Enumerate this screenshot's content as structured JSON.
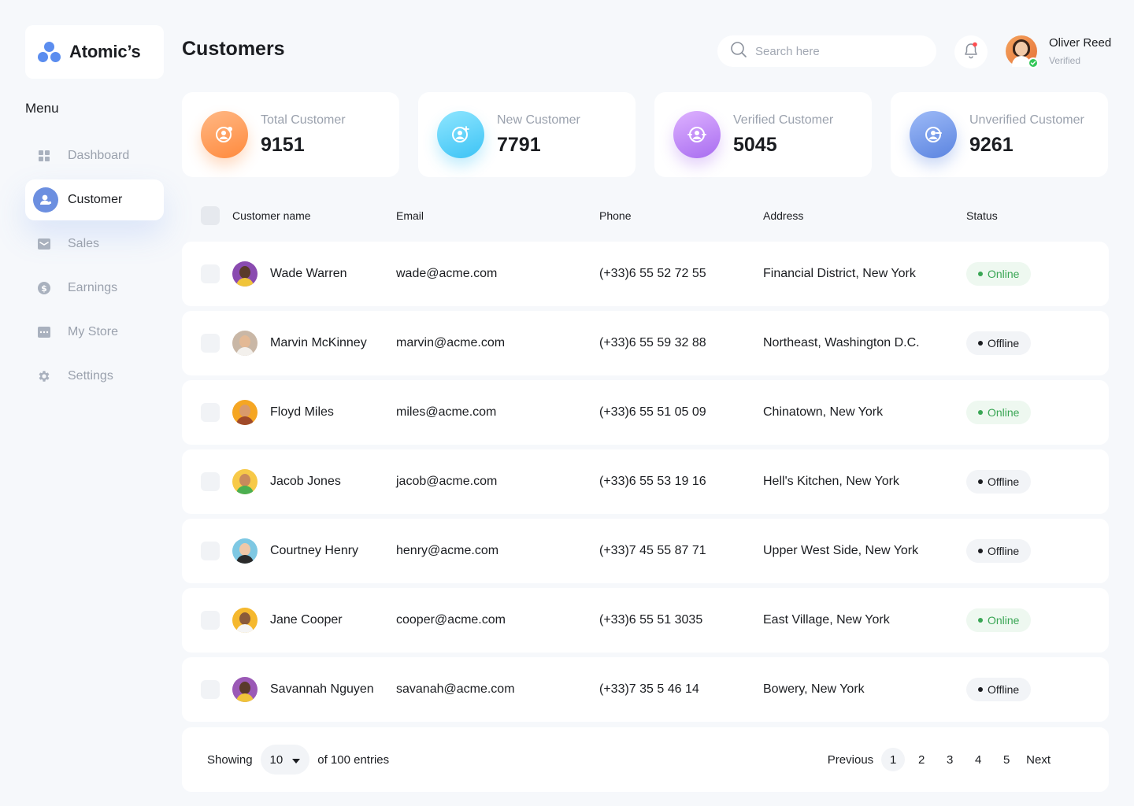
{
  "brand": {
    "name": "Atomic’s",
    "color": "#5b8def"
  },
  "sidebar": {
    "menu_title": "Menu",
    "items": [
      {
        "label": "Dashboard",
        "icon": "grid-icon",
        "active": false
      },
      {
        "label": "Customer",
        "icon": "user-icon",
        "active": true
      },
      {
        "label": "Sales",
        "icon": "inbox-icon",
        "active": false
      },
      {
        "label": "Earnings",
        "icon": "dollar-icon",
        "active": false
      },
      {
        "label": "My Store",
        "icon": "store-icon",
        "active": false
      },
      {
        "label": "Settings",
        "icon": "gear-icon",
        "active": false
      }
    ]
  },
  "header": {
    "title": "Customers",
    "search_placeholder": "Search here",
    "user": {
      "name": "Oliver Reed",
      "status": "Verified"
    }
  },
  "stats": [
    {
      "label": "Total Customer",
      "value": "9151",
      "color_from": "#ffb07a",
      "color_to": "#ff8a3d"
    },
    {
      "label": "New Customer",
      "value": "7791",
      "color_from": "#7fe0ff",
      "color_to": "#3cc3f5"
    },
    {
      "label": "Verified Customer",
      "value": "5045",
      "color_from": "#d6a6ff",
      "color_to": "#a86cf0"
    },
    {
      "label": "Unverified Customer",
      "value": "9261",
      "color_from": "#8fb0f5",
      "color_to": "#5b84e0"
    }
  ],
  "table": {
    "headers": {
      "name": "Customer name",
      "email": "Email",
      "phone": "Phone",
      "address": "Address",
      "status": "Status"
    },
    "rows": [
      {
        "name": "Wade Warren",
        "email": "wade@acme.com",
        "phone": "(+33)6 55 52 72 55",
        "address": "Financial District, New York",
        "status": "Online",
        "avatar_bg": "#8a4bb0",
        "skin": "#5a3a2a",
        "shirt": "#f0c43a"
      },
      {
        "name": "Marvin McKinney",
        "email": "marvin@acme.com",
        "phone": "(+33)6 55 59 32 88",
        "address": "Northeast, Washington D.C.",
        "status": "Offline",
        "avatar_bg": "#c9b7a6",
        "skin": "#e3b995",
        "shirt": "#f3f0ec"
      },
      {
        "name": "Floyd Miles",
        "email": "miles@acme.com",
        "phone": "(+33)6 55 51 05 09",
        "address": "Chinatown, New York",
        "status": "Online",
        "avatar_bg": "#f5a623",
        "skin": "#d99a6c",
        "shirt": "#a04a2a"
      },
      {
        "name": "Jacob Jones",
        "email": "jacob@acme.com",
        "phone": "(+33)6 55 53 19 16",
        "address": "Hell's Kitchen, New York",
        "status": "Offline",
        "avatar_bg": "#f7c948",
        "skin": "#c98a5c",
        "shirt": "#4caf50"
      },
      {
        "name": "Courtney Henry",
        "email": "henry@acme.com",
        "phone": "(+33)7 45 55 87 71",
        "address": "Upper West Side, New York",
        "status": "Offline",
        "avatar_bg": "#7ec8e3",
        "skin": "#f0c8a8",
        "shirt": "#2b2b2b"
      },
      {
        "name": "Jane Cooper",
        "email": "cooper@acme.com",
        "phone": "(+33)6 55 51 3035",
        "address": "East Village, New York",
        "status": "Online",
        "avatar_bg": "#f5b82e",
        "skin": "#8a5a3a",
        "shirt": "#f5f5f5"
      },
      {
        "name": "Savannah Nguyen",
        "email": "savanah@acme.com",
        "phone": "(+33)7 35 5 46 14",
        "address": "Bowery, New York",
        "status": "Offline",
        "avatar_bg": "#9b59b6",
        "skin": "#5a3a2a",
        "shirt": "#f0c43a"
      }
    ]
  },
  "footer": {
    "showing_label": "Showing",
    "per_page": "10",
    "entries_label": "of 100 entries",
    "previous": "Previous",
    "next": "Next",
    "pages": [
      "1",
      "2",
      "3",
      "4",
      "5"
    ],
    "current_page": "1"
  },
  "colors": {
    "online": "#3aa655",
    "online_bg": "#eef8f0",
    "offline_bg": "#f2f4f7",
    "accent": "#6c8fe0"
  }
}
